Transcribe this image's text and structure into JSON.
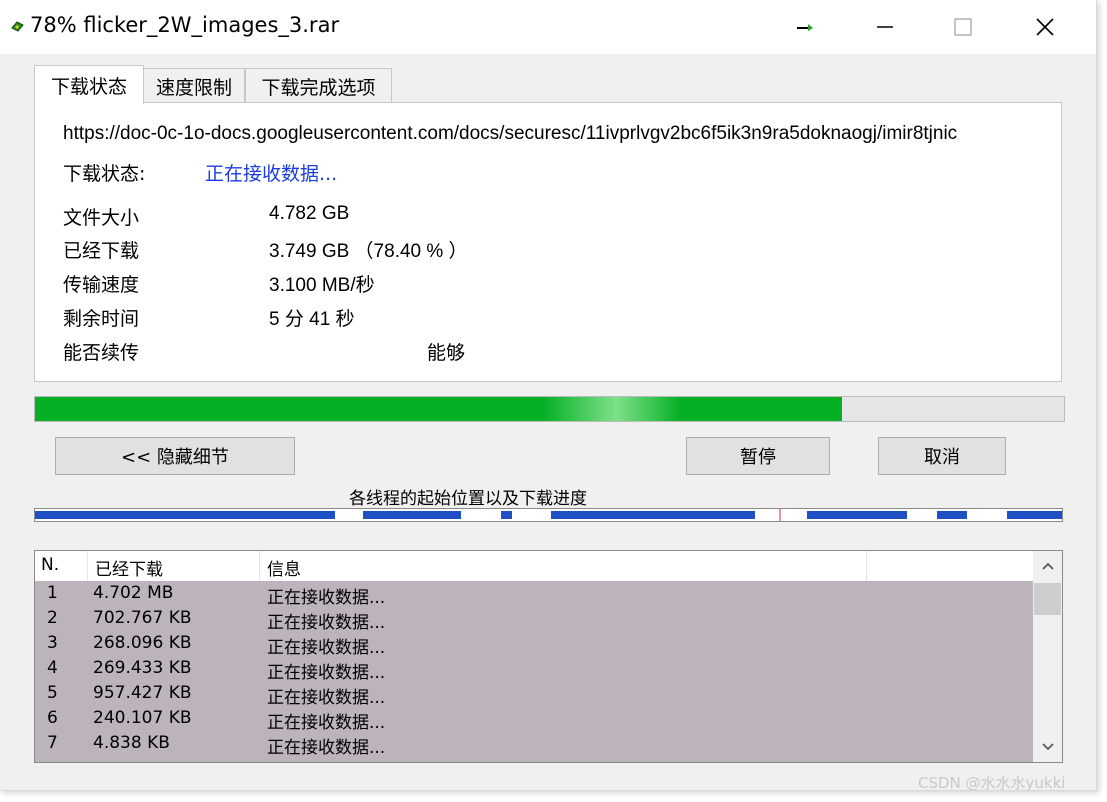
{
  "window": {
    "title": "78% flicker_2W_images_3.rar",
    "controls": {
      "minimize": "minimize-icon",
      "maximize": "maximize-icon",
      "close": "close-icon"
    }
  },
  "tabs": [
    {
      "label": "下载状态",
      "active": true
    },
    {
      "label": "速度限制",
      "active": false
    },
    {
      "label": "下载完成选项",
      "active": false
    }
  ],
  "status": {
    "url": "https://doc-0c-1o-docs.googleusercontent.com/docs/securesc/11ivprlvgv2bc6f5ik3n9ra5doknaogj/imir8tjnic",
    "status_label": "下载状态:",
    "status_value": "正在接收数据...",
    "rows": [
      {
        "label": "文件大小",
        "value": "4.782  GB"
      },
      {
        "label": "已经下载",
        "value": "3.749  GB （78.40 % ）"
      },
      {
        "label": "传输速度",
        "value": "3.100  MB/秒"
      },
      {
        "label": "剩余时间",
        "value": "5 分 41 秒"
      },
      {
        "label": "能否续传",
        "value": "能够"
      }
    ]
  },
  "progress": {
    "percent": 78.4,
    "fill_color": "#06b025"
  },
  "buttons": {
    "hide_details": "<< 隐藏细节",
    "pause": "暂停",
    "cancel": "取消"
  },
  "threads": {
    "caption": "各线程的起始位置以及下载进度"
  },
  "thread_list": {
    "columns": [
      "N.",
      "已经下载",
      "信息"
    ],
    "rows": [
      {
        "n": "1",
        "downloaded": "4.702  MB",
        "info": "正在接收数据..."
      },
      {
        "n": "2",
        "downloaded": "702.767  KB",
        "info": "正在接收数据..."
      },
      {
        "n": "3",
        "downloaded": "268.096  KB",
        "info": "正在接收数据..."
      },
      {
        "n": "4",
        "downloaded": "269.433  KB",
        "info": "正在接收数据..."
      },
      {
        "n": "5",
        "downloaded": "957.427  KB",
        "info": "正在接收数据..."
      },
      {
        "n": "6",
        "downloaded": "240.107  KB",
        "info": "正在接收数据..."
      },
      {
        "n": "7",
        "downloaded": "4.838  KB",
        "info": "正在接收数据..."
      }
    ]
  },
  "watermark": "CSDN @水水水yukki"
}
